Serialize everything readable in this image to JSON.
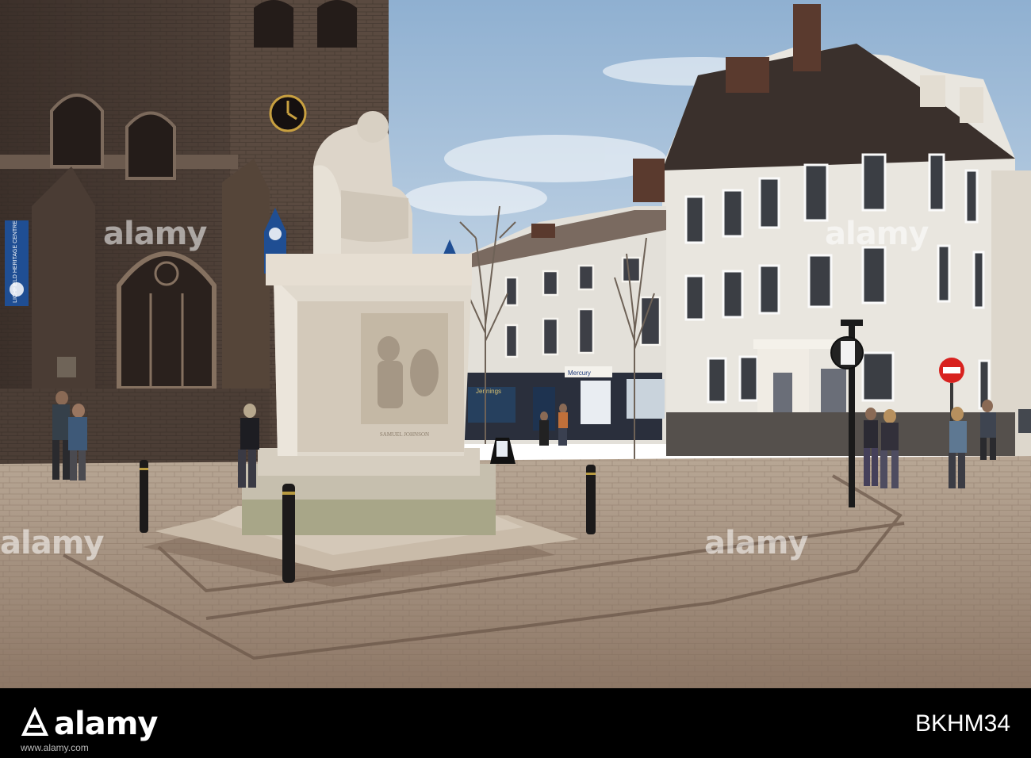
{
  "photo": {
    "description_label": "",
    "church_banner_left": "LICHFIELD HERITAGE CENTRE",
    "church_banner_right": "LICHFIELD HERITAGE CENTRE",
    "shop_sign_1": "Mercury",
    "shop_sign_2": "Jennings",
    "plaque_text": "SAMUEL JOHNSON"
  },
  "watermarks": {
    "text": "alamy"
  },
  "footer": {
    "logo_text": "alamy",
    "image_id": "BKHM34",
    "url": "www.alamy.com"
  },
  "colors": {
    "sky": "#b9cde0",
    "stone_church": "#4e4038",
    "building_white": "#e9e6df",
    "roof": "#3a302c",
    "pavement": "#a89684",
    "statue": "#ddd6cb",
    "banner_blue": "#1f4e93"
  }
}
